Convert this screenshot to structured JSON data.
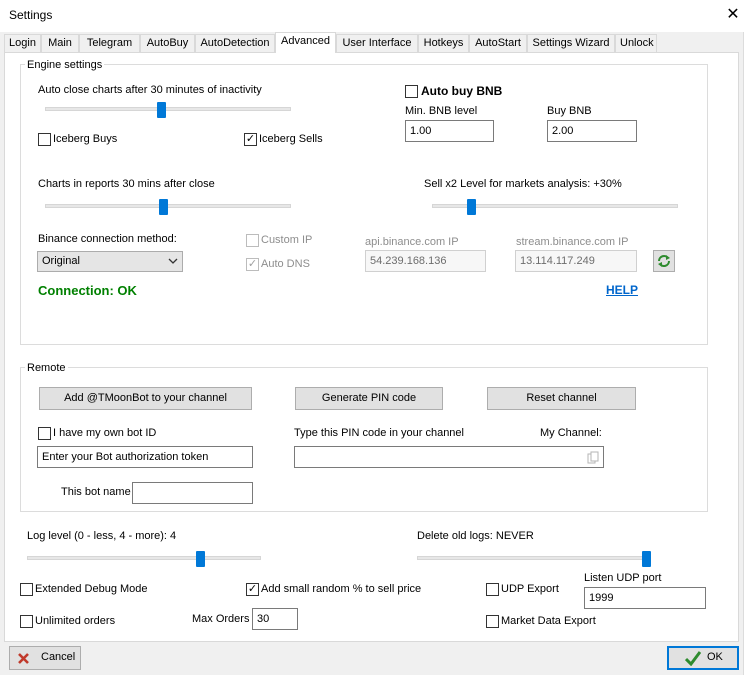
{
  "window": {
    "title": "Settings",
    "close_glyph": "✕"
  },
  "tabs": [
    "Login",
    "Main",
    "Telegram",
    "AutoBuy",
    "AutoDetection",
    "Advanced",
    "User Interface",
    "Hotkeys",
    "AutoStart",
    "Settings Wizard",
    "Unlock"
  ],
  "active_tab": "Advanced",
  "engine": {
    "group_label": "Engine settings",
    "auto_close_label": "Auto close charts after 30 minutes of inactivity",
    "auto_close_level": 0.49,
    "iceberg_buys_label": "Iceberg Buys",
    "iceberg_buys_checked": false,
    "iceberg_sells_label": "Iceberg Sells",
    "iceberg_sells_checked": true,
    "auto_buy_bnb_label": "Auto buy BNB",
    "auto_buy_bnb_checked": false,
    "min_bnb_label": "Min. BNB level",
    "min_bnb_value": "1.00",
    "buy_bnb_label": "Buy BNB",
    "buy_bnb_value": "2.00",
    "charts_reports_label": "Charts in reports 30 mins after close",
    "charts_reports_level": 0.5,
    "sell_x2_label": "Sell x2 Level for markets analysis: +30%",
    "sell_x2_level": 0.18,
    "connection_method_label": "Binance connection method:",
    "connection_method_value": "Original",
    "custom_ip_label": "Custom IP",
    "custom_ip_checked": false,
    "auto_dns_label": "Auto DNS",
    "auto_dns_checked": true,
    "api_ip_label": "api.binance.com IP",
    "api_ip_value": "54.239.168.136",
    "stream_ip_label": "stream.binance.com IP",
    "stream_ip_value": "13.114.117.249",
    "refresh_icon": "refresh-icon",
    "connection_status": "Connection: OK",
    "connection_status_color": "#008000",
    "help_link": "HELP",
    "help_link_color": "#0066cc"
  },
  "remote": {
    "group_label": "Remote",
    "add_bot_button": "Add @TMoonBot to your channel",
    "generate_pin_button": "Generate PIN code",
    "reset_channel_button": "Reset channel",
    "own_bot_label": "I have my own bot ID",
    "own_bot_checked": false,
    "bot_token_placeholder": "Enter your Bot authorization token",
    "pin_instruction": "Type this PIN code in your channel",
    "my_channel_label": "My Channel:",
    "pin_value": "",
    "copy_icon": "copy-icon",
    "bot_name_label": "This bot name",
    "bot_name_value": ""
  },
  "logging": {
    "log_level_label": "Log level (0 - less, 4 - more):  4",
    "log_level": 1.0,
    "delete_logs_label": "Delete old logs: NEVER",
    "delete_logs_level": 1.0
  },
  "bottom": {
    "extended_debug_label": "Extended Debug Mode",
    "extended_debug_checked": false,
    "random_percent_label": "Add small random % to sell price",
    "random_percent_checked": true,
    "udp_export_label": "UDP Export",
    "udp_export_checked": false,
    "listen_udp_label": "Listen UDP port",
    "listen_udp_value": "1999",
    "unlimited_orders_label": "Unlimited orders",
    "unlimited_orders_checked": false,
    "max_orders_label": "Max Orders",
    "max_orders_value": "30",
    "market_data_export_label": "Market Data Export",
    "market_data_export_checked": false
  },
  "footer": {
    "cancel_label": "Cancel",
    "cancel_icon": "cancel-x-icon",
    "ok_label": "OK",
    "ok_icon": "check-icon"
  }
}
